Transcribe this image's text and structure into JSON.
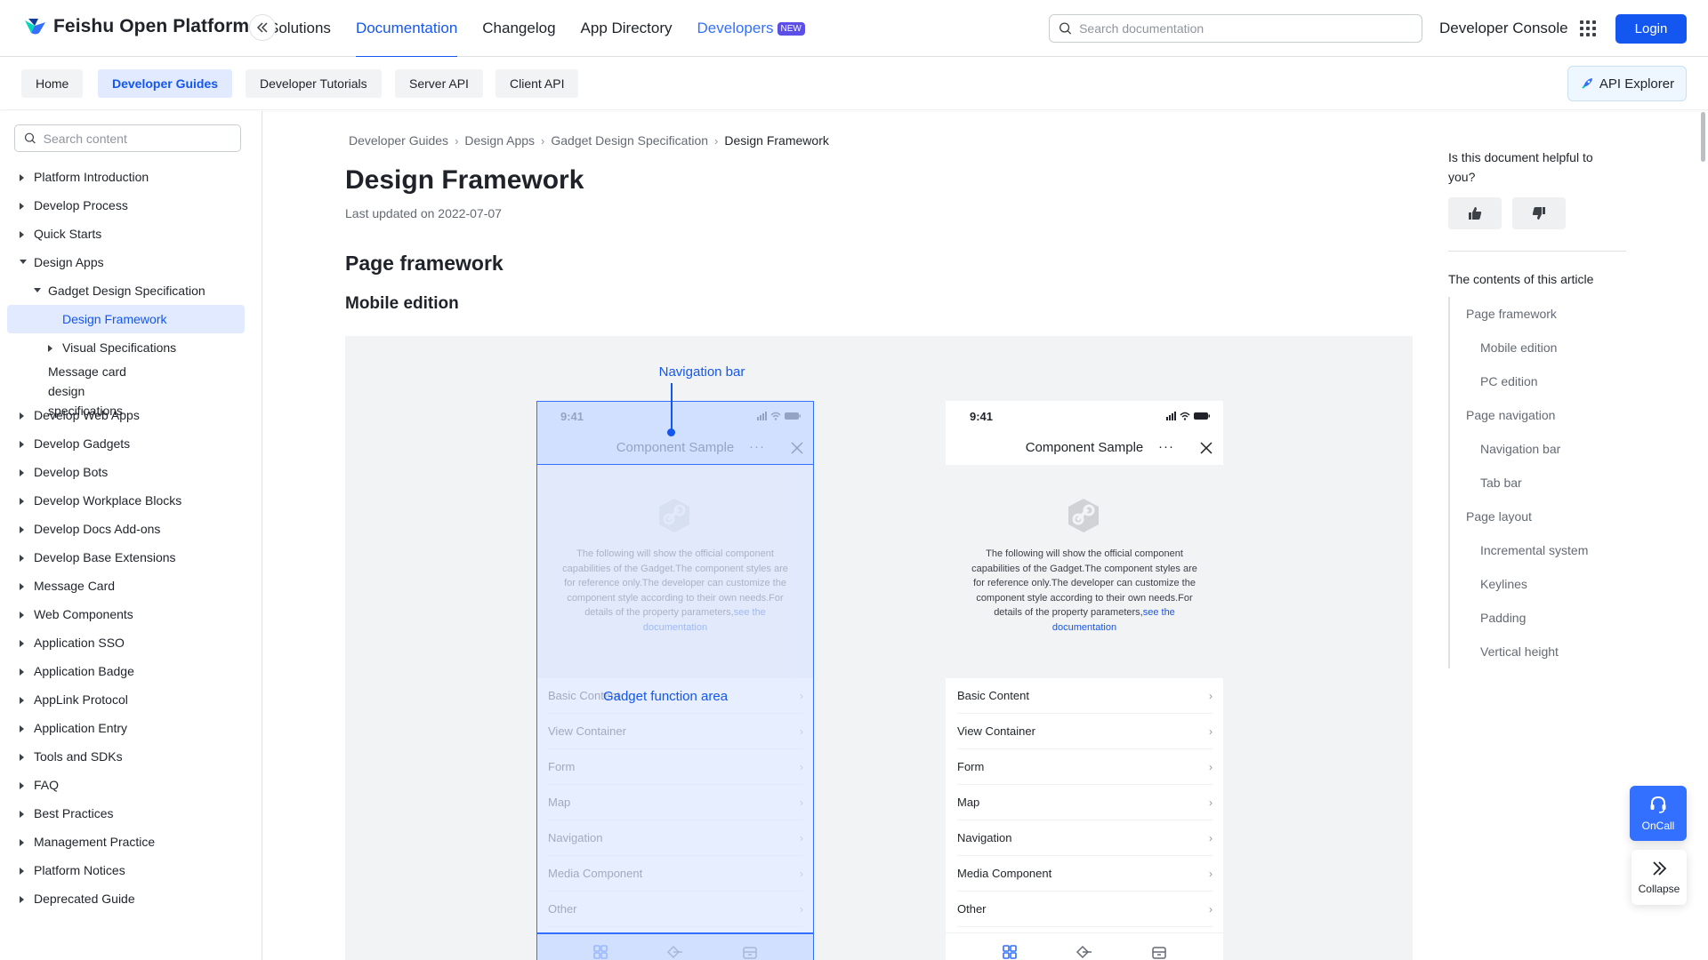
{
  "header": {
    "brand": "Feishu Open Platform",
    "nav": [
      {
        "label": "Solutions"
      },
      {
        "label": "Documentation"
      },
      {
        "label": "Changelog"
      },
      {
        "label": "App Directory"
      },
      {
        "label": "Developers",
        "badge": "NEW"
      }
    ],
    "search_placeholder": "Search documentation",
    "developer_console": "Developer Console",
    "login": "Login",
    "accent": "#1456f0"
  },
  "subnav": {
    "tabs": [
      "Home",
      "Developer Guides",
      "Developer Tutorials",
      "Server API",
      "Client API"
    ],
    "active": "Developer Guides",
    "api_explorer": "API Explorer"
  },
  "sidebar": {
    "search_placeholder": "Search content",
    "items": [
      {
        "label": "Platform Introduction",
        "level": 0,
        "expand": "right"
      },
      {
        "label": "Develop Process",
        "level": 0,
        "expand": "right"
      },
      {
        "label": "Quick Starts",
        "level": 0,
        "expand": "right"
      },
      {
        "label": "Design Apps",
        "level": 0,
        "expand": "down"
      },
      {
        "label": "Gadget Design Specification",
        "level": 1,
        "expand": "down"
      },
      {
        "label": "Design Framework",
        "level": 2,
        "expand": "none",
        "active": true
      },
      {
        "label": "Visual Specifications",
        "level": 2,
        "expand": "right"
      },
      {
        "label": "Message card design specifications",
        "level": 1,
        "expand": "none"
      },
      {
        "label": "Develop Web Apps",
        "level": 0,
        "expand": "right"
      },
      {
        "label": "Develop Gadgets",
        "level": 0,
        "expand": "right"
      },
      {
        "label": "Develop Bots",
        "level": 0,
        "expand": "right"
      },
      {
        "label": "Develop Workplace Blocks",
        "level": 0,
        "expand": "right"
      },
      {
        "label": "Develop Docs Add-ons",
        "level": 0,
        "expand": "right"
      },
      {
        "label": "Develop Base Extensions",
        "level": 0,
        "expand": "right"
      },
      {
        "label": "Message Card",
        "level": 0,
        "expand": "right"
      },
      {
        "label": "Web Components",
        "level": 0,
        "expand": "right"
      },
      {
        "label": "Application SSO",
        "level": 0,
        "expand": "right"
      },
      {
        "label": "Application Badge",
        "level": 0,
        "expand": "right"
      },
      {
        "label": "AppLink Protocol",
        "level": 0,
        "expand": "right"
      },
      {
        "label": "Application Entry",
        "level": 0,
        "expand": "right"
      },
      {
        "label": "Tools and SDKs",
        "level": 0,
        "expand": "right"
      },
      {
        "label": "FAQ",
        "level": 0,
        "expand": "right"
      },
      {
        "label": "Best Practices",
        "level": 0,
        "expand": "right"
      },
      {
        "label": "Management Practice",
        "level": 0,
        "expand": "right"
      },
      {
        "label": "Platform Notices",
        "level": 0,
        "expand": "right"
      },
      {
        "label": "Deprecated Guide",
        "level": 0,
        "expand": "right"
      }
    ]
  },
  "main": {
    "breadcrumb": [
      "Developer Guides",
      "Design Apps",
      "Gadget Design Specification",
      "Design Framework"
    ],
    "title": "Design Framework",
    "updated": "Last updated on 2022-07-07",
    "h2": "Page framework",
    "h3": "Mobile edition",
    "figure": {
      "navbar_label": "Navigation bar",
      "function_label": "Gadget function area",
      "phone": {
        "time": "9:41",
        "title": "Component Sample",
        "more": "···",
        "desc": "The following will show the official component capabilities of the  Gadget.The component styles are for reference only.The developer can customize the component style according to their own needs.For details of the property parameters,",
        "desc_link": "see the documentation",
        "rows": [
          "Basic Content",
          "View Container",
          "Form",
          "Map",
          "Navigation",
          "Media Component",
          "Other"
        ]
      }
    }
  },
  "right": {
    "helpful": "Is this document helpful to you?",
    "toc_title": "The contents of this article",
    "toc": [
      {
        "label": "Page framework",
        "level": 1
      },
      {
        "label": "Mobile edition",
        "level": 2
      },
      {
        "label": "PC edition",
        "level": 2
      },
      {
        "label": "Page navigation",
        "level": 1
      },
      {
        "label": "Navigation bar",
        "level": 2
      },
      {
        "label": "Tab bar",
        "level": 2
      },
      {
        "label": "Page layout",
        "level": 1
      },
      {
        "label": "Incremental system",
        "level": 2
      },
      {
        "label": "Keylines",
        "level": 2
      },
      {
        "label": "Padding",
        "level": 2
      },
      {
        "label": "Vertical height",
        "level": 2
      }
    ]
  },
  "floating": {
    "oncall": "OnCall",
    "collapse": "Collapse"
  }
}
